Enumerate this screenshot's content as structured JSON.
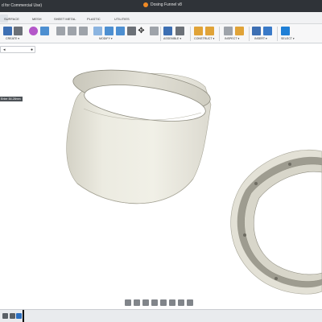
{
  "titlebar": {
    "app_text": "d for Commercial Use)",
    "document_title": "Dosing Funnel v8"
  },
  "tabs": [
    "SURFACE",
    "MESH",
    "SHEET METAL",
    "PLASTIC",
    "UTILITIES"
  ],
  "ribbon": {
    "groups": [
      "CREATE ▾",
      "MODIFY ▾",
      "ASSEMBLE ▾",
      "CONSTRUCT ▾",
      "INSPECT ▾",
      "INSERT ▾",
      "SELECT ▾"
    ]
  },
  "browser": {
    "collapse_glyph": "◂",
    "close_glyph": "●"
  },
  "dimension_tag": "Enter 84.28mm",
  "colors": {
    "ring_fill": "#ecebe1",
    "ring_shade": "#d7d5c9",
    "ring_dark": "#a9a799",
    "accent_blue": "#0b5fa5",
    "title_bar": "#2f3338"
  },
  "icons": {
    "home": "home-icon",
    "create_sketch": "sketch-icon",
    "extrude": "extrude-icon",
    "orbit": "orbit-icon",
    "select": "select-arrow-icon"
  }
}
